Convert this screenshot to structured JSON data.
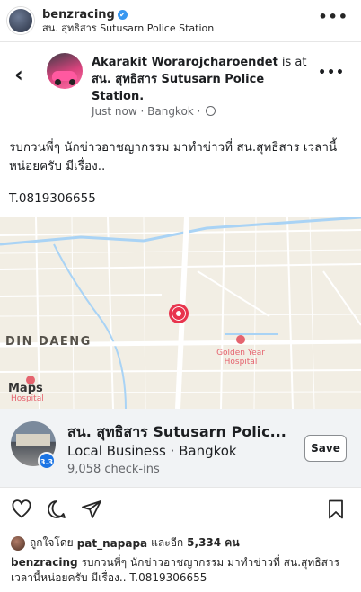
{
  "post": {
    "username": "benzracing",
    "verified_mark": "✔",
    "location": "สน. สุทธิสาร Sutusarn Police Station",
    "more": "•••"
  },
  "fb": {
    "back": "‹",
    "author": "Akarakit Worarojcharoendet",
    "is_at": " is at ",
    "place_bold": "สน. สุทธิสาร Sutusarn Police Station.",
    "meta": "Just now · Bangkok · ",
    "more": "•••",
    "text": "รบกวนพี่ๆ นักข่าวอาชญากรรม มาทำข่าวที่ สน.สุทธิสาร เวลานี้หน่อยครับ มีเรื่อง..",
    "phone": "T.0819306655"
  },
  "map": {
    "district": "DIN DAENG",
    "poi": "Golden Year Hospital",
    "poi2": "Hospital",
    "logo": "Maps"
  },
  "place": {
    "name": "สน. สุทธิสาร Sutusarn Polic...",
    "category": "Local Business · Bangkok",
    "checkins": "9,058 check-ins",
    "rating": "3.3",
    "save": "Save"
  },
  "actions": {
    "icons": [
      "heart-icon",
      "comment-icon",
      "share-icon",
      "bookmark-icon"
    ]
  },
  "likes": {
    "prefix": "ถูกใจโดย",
    "user": "pat_napapa",
    "and": "และอีก",
    "count": "5,334 คน"
  },
  "caption": {
    "user": "benzracing",
    "text": " รบกวนพี่ๆ นักข่าวอาชญากรรม มาทำข่าวที่ สน.สุทธิสาร เวลานี้หน่อยครับ มีเรื่อง.. T.0819306655"
  },
  "colors": {
    "accent": "#3897f0",
    "pin": "#e8344d",
    "map_bg": "#f2eee4"
  }
}
